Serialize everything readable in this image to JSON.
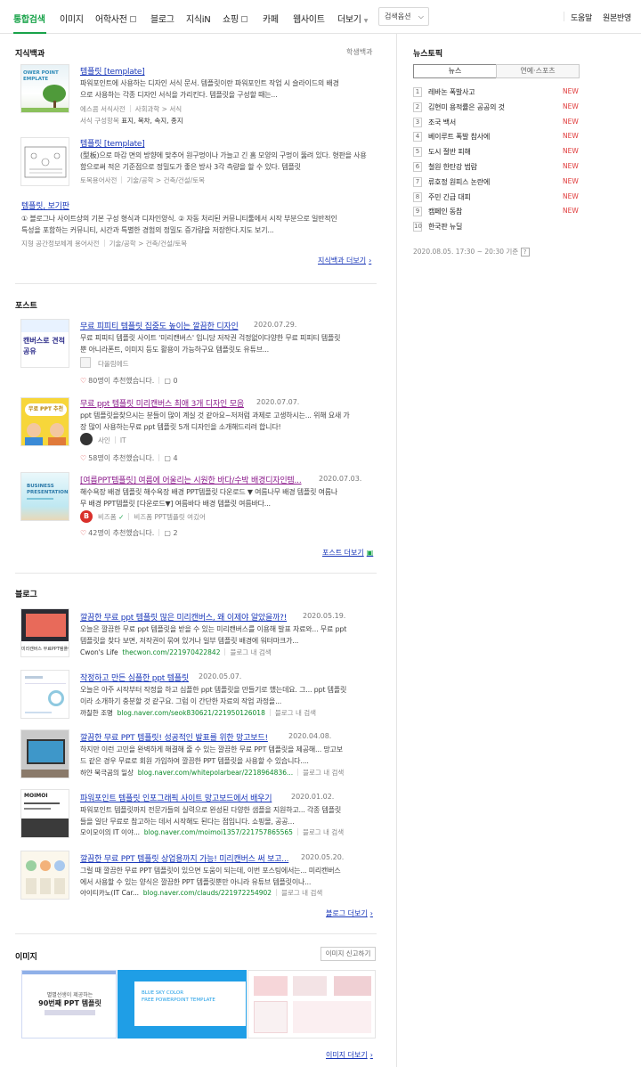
{
  "nav": {
    "tabs": [
      {
        "label": "통합검색"
      },
      {
        "label": "이미지"
      },
      {
        "label": "어학사전"
      },
      {
        "label": "블로그"
      },
      {
        "label": "지식iN"
      },
      {
        "label": "쇼핑"
      },
      {
        "label": "카페"
      },
      {
        "label": "웹사이트"
      },
      {
        "label": "더보기"
      }
    ],
    "search_option": "검색옵션",
    "help": "도움말",
    "original": "원본반영"
  },
  "encyc": {
    "title": "지식백과",
    "right_link": "학생백과",
    "items": [
      {
        "thumb_text_1": "OWER POINT",
        "thumb_text_2": "EMPLATE",
        "title": "템플릿 [template]",
        "desc_1": "파워포인트에 사용하는 디자인 서식 문서. 템플릿이란 파워포인트 작업 시 슬라이드의 배경",
        "desc_2": "으로 사용하는 각종 디자인 서식을 가리킨다. 템플릿을 구성할 때는...",
        "source": "에스콤 서식사전",
        "path": "사회과학 > 서식",
        "extra_label": "서식 구성항목",
        "extra_value": "표지, 목차, 속지, 종지"
      },
      {
        "title": "템플릿 [template]",
        "desc_1": "(型板)으로 마감 면의 방향에 맞추어 원구멍이나 가늘고 긴 홈 모양의 구멍이 뚫려 있다. 형판을 사용",
        "desc_2": "함으로써 적은 기준점으로 정밀도가 좋은 방사 3각 측량을 할 수 있다. 템플릿",
        "source": "토목용어사전",
        "path": "기술/공학 > 건축/건설/토목"
      },
      {
        "title": "템플릿",
        "title_suffix": "보기판",
        "desc_1": "① 블로그나 사이트상의 기본 구성 형식과 디자인양식. ② 자동 처리된 커뮤니티툴에서 시작 부분으로 일반적인",
        "desc_2": "특성을 포함하는 커뮤니티, 시간과 특별한 경험의 정밀도 증가량을 저장한다.지도 보기...",
        "source": "지형 공간정보체계 용어사전",
        "path": "기술/공학 > 건축/건설/토목"
      }
    ],
    "more": "지식백과 더보기"
  },
  "post": {
    "title": "포스트",
    "items": [
      {
        "thumb_text": "캔버스로 견적 공유",
        "title": "무료 피피티 템플릿 집중도 높이는 깔끔한 디자인",
        "date": "2020.07.29.",
        "desc_1": "무료 피피티 템플릿 사이트 '미리캔버스' 입니당 저작권 걱정없이다양한 무료 피피티 템플릿",
        "desc_2": "뿐 아니라폰트, 이미지 등도 활용이 가능하구요 템플릿도 유튜브...",
        "author": "다올림에드",
        "likes": "80명이 추천했습니다.",
        "comments": "0"
      },
      {
        "thumb_text": "무료 PPT 추천",
        "title": "무료 ppt 템플릿 미리캔버스 최애 3개 디자인 모음",
        "date": "2020.07.07.",
        "desc_1": "ppt 템플릿을찾으시는 분들이 많이 계실 것 같아요~저저럼 과제로 고생하시는... 위해 요새 가",
        "desc_2": "장 많이 사용하는무료 ppt 템플릿 5개 디자인을 소개해드리려 합니다!",
        "author": "사인",
        "author_tag": "IT",
        "likes": "58명이 추천했습니다.",
        "comments": "4"
      },
      {
        "thumb_text_1": "BUSINESS",
        "thumb_text_2": "PRESENTATION",
        "title": "[여름PPT템플릿] 여름에 어울리는 시원한 바다/수박 배경디자인템...",
        "date": "2020.07.03.",
        "desc_1": "해수욕장 배경 템플릿 해수욕장 배경 PPT템플릿 다운로드 ▼   여름나무 배경 템플릿 여름나",
        "desc_2": "무 배경 PPT템플릿 [다운로드▼]   여름바다 배경 템플릿 여름바다...",
        "author": "비즈폼",
        "author_tag": "비즈폼 PPT템플릿 여깄어",
        "avatar_letter": "B",
        "likes": "42명이 추천했습니다.",
        "comments": "2"
      }
    ],
    "more": "포스트 더보기"
  },
  "blog": {
    "title": "블로그",
    "items": [
      {
        "title": "깔끔한 무료 ppt 템플릿 많은 미리캔버스, 왜 이제야 알았을까?!",
        "date": "2020.05.19.",
        "desc_1": "오늘은 깔끔한 무료 ppt 템플릿을 받을 수 있는 미리캔버스를 이용해 발표 자료와... 무료 ppt",
        "desc_2": "템플릿을 찾다 보면, 저작권이 묶여 있거나 일부 템플릿 배경에 워터마크가...",
        "blog_name": "Cwon's Life",
        "url": "thecwon.com/221970422842",
        "inner": "블로그 내 검색",
        "thumb_text": "미리캔버스 무료PPT템플릿"
      },
      {
        "title": "작정하고 만든 심플한 ppt 템플릿",
        "date": "2020.05.07.",
        "desc_1": "오늘은 아주 시작부터 작정을 하고 심플한 ppt 템플릿을 만들기로 했는데요. 그... ppt 템플릿",
        "desc_2": "이라 소개하기 충분할 것 같구요. 그럼 이 간단한 자료의 작업 과정을...",
        "blog_name": "까칠한 조명",
        "url": "blog.naver.com/seok830621/221950126018",
        "inner": "블로그 내 검색"
      },
      {
        "title": "깔끔한 무료 PPT 템플릿! 성공적인 발표를 위한 망고보드!",
        "date": "2020.04.08.",
        "desc_1": "하지만 이런 고민을 완벽하게 해결해 줄 수 있는 깔끔한 무료 PPT 템플릿을 제공해... 망고보",
        "desc_2": "드 같은 경우 무료로 회원 가입하여 깔끔한 PPT 템플릿을 사용할 수 있습니다....",
        "blog_name": "하얀 북극곰의 일상",
        "url": "blog.naver.com/whitepolarbear/2218964836...",
        "inner": "블로그 내 검색"
      },
      {
        "title": "파워포인트 템플릿 인포그래픽 사이트 망고보드에서 배우기",
        "date": "2020.01.02.",
        "desc_1": "파워포인트 템플릿까지 전문가들의 실력으로 완성된 다양한 샘플을 지원하고... 각종 템플릿",
        "desc_2": "들을 일단 무료로 참고하는 데서 시작해도 된다는 점입니다. 쇼핑몰, 공공...",
        "blog_name": "모이모이의 IT 이야...",
        "url": "blog.naver.com/moimoi1357/221757865565",
        "inner": "블로그 내 검색",
        "thumb_text": "MOIMOI"
      },
      {
        "title": "깔끔한 무료 PPT 템플릿 상업용까지 가능! 미리캔버스 써 보고...",
        "date": "2020.05.20.",
        "desc_1": "그럴 때 깔끔한 무료 PPT 템플릿이 있으면 도움이 되는데, 이번 포스팅에서는... 미리캔버스",
        "desc_2": "에서 사용할 수 있는 양식은 깔끔한 PPT 템플릿뿐만 아니라 유튜브 템플릿이나...",
        "blog_name": "아이티카노(IT Car...",
        "url": "blog.naver.com/clauds/221972254902",
        "inner": "블로그 내 검색"
      }
    ],
    "more": "블로그 더보기"
  },
  "images": {
    "title": "이미지",
    "report": "이미지 신고하기",
    "img1_line1": "별별선생이 제공하는",
    "img1_line2": "90번째 PPT 템플릿",
    "img2_line1": "BLUE SKY COLOR",
    "img2_line2": "FREE POWERPOINT TEMPLATE",
    "more": "이미지 더보기"
  },
  "news_topic": {
    "title": "뉴스토픽",
    "tabs": [
      {
        "label": "뉴스"
      },
      {
        "label": "연예·스포츠"
      }
    ],
    "items": [
      {
        "rank": "1",
        "text": "레바논 폭발사고",
        "new": "NEW"
      },
      {
        "rank": "2",
        "text": "김현미 용적률은 공공의 것",
        "new": "NEW"
      },
      {
        "rank": "3",
        "text": "조국 백서",
        "new": "NEW"
      },
      {
        "rank": "4",
        "text": "베이루트 폭발 참사에",
        "new": "NEW"
      },
      {
        "rank": "5",
        "text": "도시 절반 피해",
        "new": "NEW"
      },
      {
        "rank": "6",
        "text": "철원 한탄강 범람",
        "new": "NEW"
      },
      {
        "rank": "7",
        "text": "류호정 원피스 논란에",
        "new": "NEW"
      },
      {
        "rank": "8",
        "text": "주민 긴급 대피",
        "new": "NEW"
      },
      {
        "rank": "9",
        "text": "캠페인 동참",
        "new": "NEW"
      },
      {
        "rank": "10",
        "text": "한국판 뉴딜",
        "new": ""
      }
    ],
    "time": "2020.08.05. 17:30 ~ 20:30 기준",
    "help_icon": "?"
  },
  "colors": {
    "accent": "#19a34a",
    "link": "#1836b8",
    "new": "#e03b3b"
  }
}
